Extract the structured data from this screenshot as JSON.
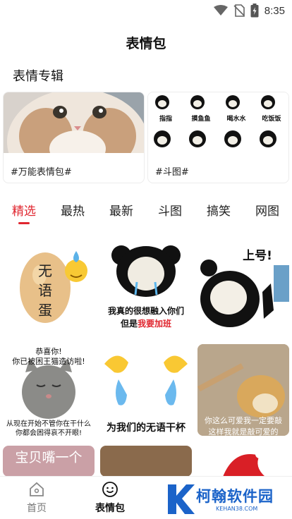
{
  "status_bar": {
    "time": "8:35",
    "icons": [
      "wifi-icon",
      "no-sim-icon",
      "battery-charging-icon"
    ]
  },
  "page": {
    "title": "表情包"
  },
  "albums": {
    "section_title": "表情专辑",
    "items": [
      {
        "label": "#万能表情包#",
        "thumb": "cat-closeup"
      },
      {
        "label": "#斗图#",
        "thumb": "panda-meme-grid",
        "thumb_captions": [
          "指指",
          "摸鱼鱼",
          "喝水水",
          "吃饭饭"
        ]
      }
    ]
  },
  "tabs": {
    "items": [
      "精选",
      "最热",
      "最新",
      "斗图",
      "搞笑",
      "网图"
    ],
    "active_index": 0,
    "accent_color": "#e0262f"
  },
  "grid": {
    "items": [
      {
        "kind": "egg",
        "caption": "无语蛋"
      },
      {
        "kind": "panda-cry",
        "caption_line1": "我真的很想融入你们",
        "caption_line2_prefix": "但是",
        "caption_line2_highlight": "我要加班"
      },
      {
        "kind": "panda-shangha",
        "caption": "上号!"
      },
      {
        "kind": "cat",
        "caption_top1": "恭喜你!",
        "caption_top2": "你已被困王猫造访啦!",
        "caption_bottom1": "从现在开始不管你在干什么",
        "caption_bottom2": "你都会困得哀不开眼!"
      },
      {
        "kind": "hands-tears",
        "caption": "为我们的无语干杯"
      },
      {
        "kind": "doge",
        "caption_line1": "你这么可爱我一定要敲",
        "caption_line2": "这样我就是敲可爱的"
      },
      {
        "kind": "baby",
        "caption": "宝贝嘴一个"
      },
      {
        "kind": "blurred-animal"
      },
      {
        "kind": "santa"
      }
    ]
  },
  "bottom_nav": {
    "items": [
      {
        "label": "首页",
        "icon": "home-icon",
        "active": false
      },
      {
        "label": "表情包",
        "icon": "smile-face-icon",
        "active": true
      }
    ]
  },
  "watermark": {
    "text": "柯翰软件园",
    "sub": "KEHAN38.COM",
    "color": "#1b63c9"
  }
}
